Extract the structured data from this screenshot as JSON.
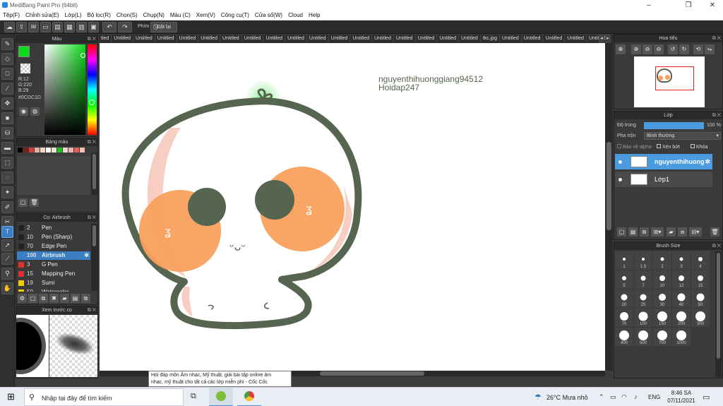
{
  "window": {
    "title": "MediBang Paint Pro (64bit)",
    "min_icon": "minimize-icon",
    "max_icon": "maximize-icon",
    "close_icon": "close-icon"
  },
  "menu": [
    "Tệp(F)",
    "Chỉnh sửa(E)",
    "Lớp(L)",
    "Bộ lọc(R)",
    "Chọn(S)",
    "Chụp(N)",
    "Màu (C)",
    "Xem(V)",
    "Công cụ(T)",
    "Cửa sổ(W)",
    "Cloud",
    "Help"
  ],
  "toolbar": {
    "snap_label": "Phím",
    "reset_label": "Đặt lại"
  },
  "color_panel": {
    "title": "Màu",
    "r": "R:12",
    "g": "G:220",
    "b": "B:29",
    "hex": "#0CDC1D",
    "primary": "#0cdc1d",
    "secondary": "#000000"
  },
  "palette_panel": {
    "title": "Bảng màu",
    "swatches": [
      "#000000",
      "#7a2020",
      "#d04040",
      "#e0b0a0",
      "#f5d5c5",
      "#ffffff",
      "#f0e0d0",
      "#1fc01f",
      "#e8d8d0",
      "#f0b0b0",
      "#e06060",
      "#f4c0b0"
    ]
  },
  "brush_panel": {
    "title": "Cọ: Airbrush",
    "items": [
      {
        "num": "2",
        "name": "Pen",
        "color": "#222222"
      },
      {
        "num": "10",
        "name": "Pen (Sharp)",
        "color": "#222222"
      },
      {
        "num": "70",
        "name": "Edge Pen",
        "color": "#222222"
      },
      {
        "num": "100",
        "name": "Airbrush",
        "color": "#3a7fc1",
        "selected": true
      },
      {
        "num": "3",
        "name": "G Pen",
        "color": "#e03030"
      },
      {
        "num": "15",
        "name": "Mapping Pen",
        "color": "#e03030"
      },
      {
        "num": "19",
        "name": "Sumi",
        "color": "#e8d000"
      },
      {
        "num": "50",
        "name": "Watercolor",
        "color": "#e8d000"
      }
    ]
  },
  "preview_panel": {
    "title": "Xem trước cọ"
  },
  "tabs": [
    "tled",
    "Untitled",
    "Untitled",
    "Untitled",
    "Untitled",
    "Untitled",
    "Untitled",
    "Untitled",
    "Untitled",
    "Untitled",
    "Untitled",
    "Untitled",
    "Untitled",
    "Untitled",
    "Untitled",
    "Untitled",
    "Untitled",
    "Untitled",
    "tkc.jpg",
    "Untitled",
    "Untitled",
    "Untitled",
    "Untitled",
    "Untitled"
  ],
  "canvas": {
    "text_line1": "nguyenthihuonggiang94512",
    "text_line2": "Hoidap247",
    "mouth": "ᵕᴗᵕ",
    "blush_mark": "ʓ"
  },
  "navigator": {
    "title": "Hoa tiêu"
  },
  "layer_panel": {
    "title": "Lớp",
    "opacity_label": "Độ trong",
    "opacity_value": "100 %",
    "opacity": 1.0,
    "blend_label": "Pha trộn",
    "blend_value": "Bình thường",
    "protect_alpha": "Bảo vệ alpha",
    "clipping": "Xén bớt",
    "lock": "Khóa",
    "layers": [
      {
        "name": "nguyenthihuong",
        "selected": true
      },
      {
        "name": "Lớp1",
        "selected": false
      }
    ]
  },
  "brush_size_panel": {
    "title": "Brush Size",
    "sizes": [
      "1",
      "1.5",
      "2",
      "3",
      "4",
      "5",
      "7",
      "10",
      "12",
      "15",
      "20",
      "25",
      "30",
      "40",
      "50",
      "70",
      "100",
      "150",
      "200",
      "300",
      "400",
      "500",
      "700",
      "1000"
    ]
  },
  "tooltip": {
    "line1": "Hỏi đáp môn Âm nhạc, Mỹ thuật, giải bài tập online âm",
    "line2": "nhạc, mỹ thuật cho tất cả các lớp miễn phí - Cốc Cốc"
  },
  "taskbar": {
    "search_placeholder": "Nhập tại đây để tìm kiếm",
    "weather": "26°C  Mưa nhỏ",
    "lang": "ENG",
    "time": "8:46 SA",
    "date": "07/11/2021"
  }
}
